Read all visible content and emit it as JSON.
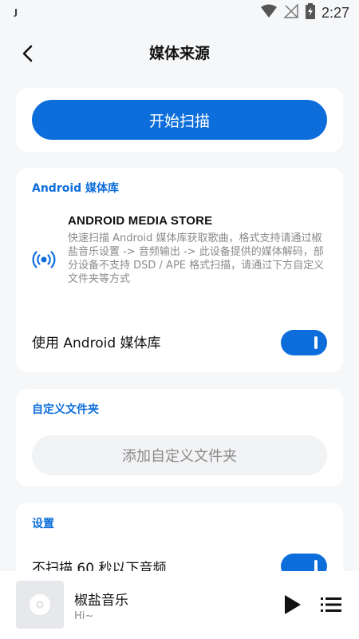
{
  "status_bar": {
    "left_indicator": "J",
    "time": "2:27",
    "icons": [
      "wifi-icon",
      "signal-off-icon",
      "battery-charging-icon"
    ]
  },
  "app_bar": {
    "title": "媒体来源",
    "back_icon": "chevron-left-icon"
  },
  "scan": {
    "button_label": "开始扫描"
  },
  "android_section": {
    "title": "Android 媒体库",
    "store_icon": "broadcast-icon",
    "store_title": "ANDROID MEDIA STORE",
    "store_description": "快速扫描 Android 媒体库获取歌曲，格式支持请通过椒盐音乐设置 -> 音频输出 -> 此设备提供的媒体解码，部分设备不支持 DSD / APE 格式扫描，请通过下方自定义文件夹等方式",
    "use_label": "使用 Android 媒体库",
    "use_enabled": true
  },
  "custom_section": {
    "title": "自定义文件夹",
    "add_button_label": "添加自定义文件夹"
  },
  "settings_section": {
    "title": "设置",
    "skip_short_label": "不扫描 60 秒以下音频",
    "skip_short_enabled": true
  },
  "player": {
    "title": "椒盐音乐",
    "subtitle": "Hi~",
    "play_icon": "play-icon",
    "list_icon": "playlist-icon"
  },
  "colors": {
    "accent": "#0d6edb",
    "background": "#f6f7f9",
    "card": "#ffffff",
    "muted_text": "#8a8a8a"
  }
}
